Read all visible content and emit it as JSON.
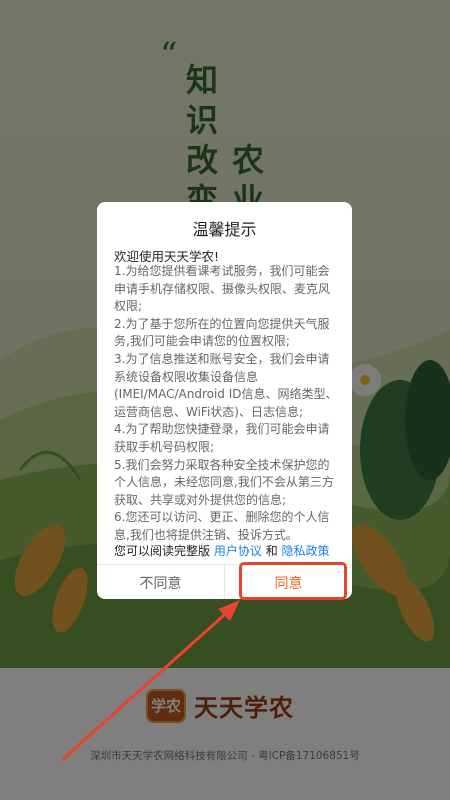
{
  "slogan": {
    "quote_mark": "“",
    "col1": [
      "知",
      "识",
      "改",
      "变"
    ],
    "col2": [
      "农",
      "业"
    ]
  },
  "dialog": {
    "title": "温馨提示",
    "welcome": "欢迎使用天天学农!",
    "terms": [
      "1.为给您提供看课考试服务，我们可能会申请手机存储权限、摄像头权限、麦克风权限;",
      "2.为了基于您所在的位置向您提供天气服务,我们可能会申请您的位置权限;",
      "3.为了信息推送和账号安全，我们会申请系统设备权限收集设备信息(IMEI/MAC/Android ID信息、网络类型、运营商信息、WiFi状态)、日志信息;",
      "4.为了帮助您快捷登录，我们可能会申请获取手机号码权限;",
      "5.我们会努力采取各种安全技术保护您的个人信息，未经您同意,我们不会从第三方获取、共享或对外提供您的信息;",
      "6.您还可以访问、更正、删除您的个人信息,我们也将提供注销、投诉方式。"
    ],
    "read_prefix": "您可以阅读完整版",
    "user_agreement": "用户协议",
    "conjunction": "和",
    "privacy_policy": "隐私政策",
    "disagree": "不同意",
    "agree": "同意"
  },
  "footer": {
    "logo_text": "学农",
    "brand": "天天学农",
    "company": "深圳市天天学农网络科技有限公司 - 粤ICP备17106851号"
  },
  "colors": {
    "agree": "#f0682a",
    "link": "#1e80e5",
    "brand": "#9c3d12",
    "annotation": "#e8432e"
  }
}
